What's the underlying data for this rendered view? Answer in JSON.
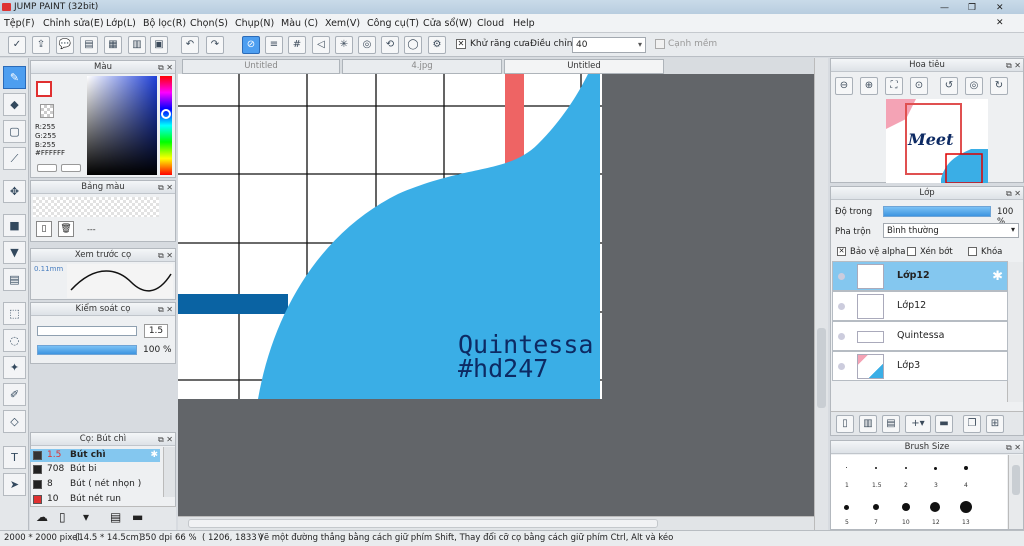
{
  "app": {
    "title": "JUMP PAINT (32bit)"
  },
  "menu": [
    "Tệp(F)",
    "Chỉnh sửa(E)",
    "Lớp(L)",
    "Bộ lọc(R)",
    "Chọn(S)",
    "Chụp(N)",
    "Màu (C)",
    "Xem(V)",
    "Công cụ(T)",
    "Cửa sổ(W)",
    "Cloud",
    "Help"
  ],
  "toolbar": {
    "antialias_label": "Khử răng cưa",
    "adjust_label": "Điều chỉnh",
    "adjust_value": "40",
    "edge_label": "Cạnh mềm"
  },
  "tabs": [
    "Untitled",
    "4.jpg",
    "Untitled"
  ],
  "color_panel": {
    "title": "Màu",
    "r": "R:255",
    "g": "G:255",
    "b": "B:255",
    "hex": "#FFFFFF",
    "primary": "#ffffff",
    "accent": "#e83030"
  },
  "palette_panel": {
    "title": "Bảng màu",
    "placeholder": "---"
  },
  "brush_preview": {
    "title": "Xem trước cọ",
    "size": "0.11mm"
  },
  "brush_control": {
    "title": "Kiểm soát cọ",
    "size": "1.5",
    "opacity": "100 %",
    "opacity_fraction": 1.0
  },
  "brush_list": {
    "title": "Cọ: Bút chì",
    "items": [
      {
        "size": "1.5",
        "name": "Bút chì",
        "selected": true,
        "color": "#333333"
      },
      {
        "size": "708",
        "name": "Bút bi",
        "selected": false,
        "color": "#222222"
      },
      {
        "size": "8",
        "name": "Bút ( nét nhọn )",
        "selected": false,
        "color": "#222222"
      },
      {
        "size": "10",
        "name": "Bút nét run",
        "selected": false,
        "color": "#e03030"
      }
    ]
  },
  "navigator": {
    "title": "Hoa tiêu",
    "thumb_text": "Meet"
  },
  "layers": {
    "title": "Lớp",
    "opacity_label": "Độ trong",
    "opacity_value": "100 %",
    "opacity_fraction": 1.0,
    "blend_label": "Pha trộn",
    "blend_value": "Bình thường",
    "protect_alpha": "Bảo vệ alpha",
    "clip": "Xén bớt",
    "lock": "Khóa",
    "items": [
      {
        "name": "Lớp12",
        "selected": true
      },
      {
        "name": "Lớp12",
        "selected": false
      },
      {
        "name": "Quintessa",
        "selected": false
      },
      {
        "name": "Lớp3",
        "selected": false
      }
    ]
  },
  "brush_size_panel": {
    "title": "Brush Size",
    "labels": [
      "1",
      "1.5",
      "2",
      "3",
      "4",
      "5",
      "7",
      "10",
      "12",
      "13"
    ]
  },
  "canvas": {
    "text_line1": "Quintessa",
    "text_line2": "#hd247",
    "blue": "#3aaee6",
    "dark_blue": "#0a63a3",
    "red": "#ee6464"
  },
  "status": {
    "size": "2000 * 2000 pixel",
    "physical": "(14.5 * 14.5cm)",
    "dpi": "350 dpi",
    "zoom": "66 %",
    "coords": "( 1206, 1833 )",
    "hint": "Vẽ một đường thẳng bằng cách giữ phím Shift, Thay đổi cỡ cọ bằng cách giữ phím Ctrl, Alt và kéo"
  }
}
